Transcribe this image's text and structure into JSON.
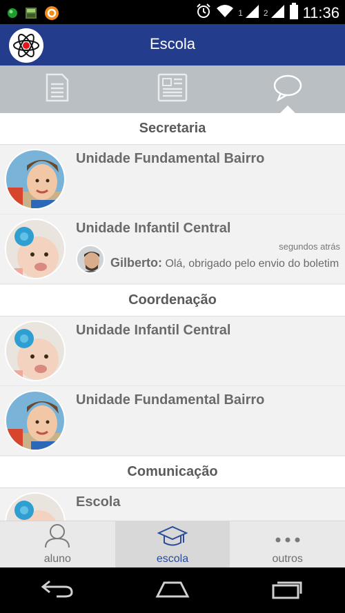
{
  "status_bar": {
    "time": "11:36",
    "sim1": "1",
    "sim2": "2"
  },
  "app_bar": {
    "title": "Escola"
  },
  "tabs": [
    {
      "icon": "document-icon",
      "active": false
    },
    {
      "icon": "newspaper-icon",
      "active": false
    },
    {
      "icon": "chat-bubble-icon",
      "active": true
    }
  ],
  "sections": [
    {
      "header": "Secretaria",
      "rows": [
        {
          "title": "Unidade Fundamental Bairro",
          "avatar": "child-photo"
        },
        {
          "title": "Unidade Infantil Central",
          "avatar": "baby-photo",
          "time": "segundos atrás",
          "sender": "Gilberto:",
          "message": "Olá, obrigado pelo envio do boletim"
        }
      ]
    },
    {
      "header": "Coordenação",
      "rows": [
        {
          "title": "Unidade Infantil Central",
          "avatar": "baby-photo"
        },
        {
          "title": "Unidade Fundamental Bairro",
          "avatar": "child-photo"
        }
      ]
    },
    {
      "header": "Comunicação",
      "rows": [
        {
          "title": "Escola",
          "avatar": "baby-photo"
        }
      ]
    }
  ],
  "bottom_nav": [
    {
      "label": "aluno",
      "icon": "person-icon",
      "active": false
    },
    {
      "label": "escola",
      "icon": "graduation-cap-icon",
      "active": true
    },
    {
      "label": "outros",
      "icon": "more-dots-icon",
      "active": false
    }
  ],
  "colors": {
    "app_bar": "#243c8c",
    "tabs_bg": "#b9bfc3",
    "active_nav": "#2a4b9a"
  }
}
